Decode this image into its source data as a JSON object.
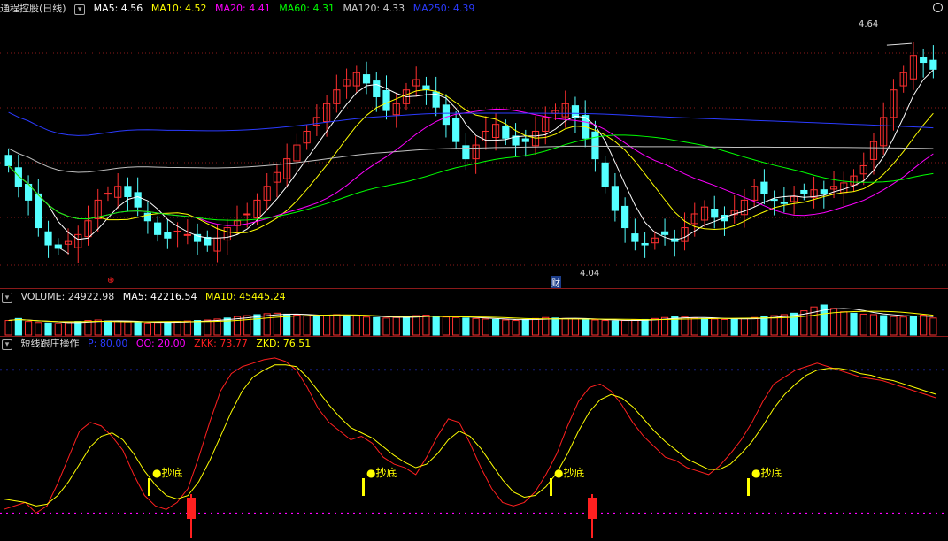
{
  "colors": {
    "ma5": "#ffffff",
    "ma10": "#ffff00",
    "ma20": "#ff00ff",
    "ma60": "#00ff00",
    "ma120": "#c0c0c0",
    "ma250": "#2b3bff",
    "up": "#ff3030",
    "down": "#54ffff",
    "zkk": "#ff2020",
    "zkd": "#ffff00",
    "grid": "#8b1a1a"
  },
  "price_header": {
    "title": "通程控股(日线)",
    "ma5": "MA5: 4.56",
    "ma10": "MA10: 4.52",
    "ma20": "MA20: 4.41",
    "ma60": "MA60: 4.31",
    "ma120": "MA120: 4.33",
    "ma250": "MA250: 4.39"
  },
  "volume_header": {
    "title": "VOLUME: 24922.98",
    "ma5": "MA5: 42216.54",
    "ma10": "MA10: 45445.24"
  },
  "indicator_header": {
    "title": "短线跟庄操作",
    "p": "P: 80.00",
    "oo": "OO: 20.00",
    "zkk": "ZKK: 73.77",
    "zkd": "ZKD: 76.51"
  },
  "annotations": {
    "high_label": "4.64",
    "low_label": "4.04",
    "finance_marker": "财",
    "red_marker": "⊕",
    "buy_signal": "抄底"
  },
  "chart_data": [
    {
      "type": "candlestick",
      "title": "通程控股(日线)",
      "ylim": [
        3.95,
        4.72
      ],
      "series_names": [
        "MA5",
        "MA10",
        "MA20",
        "MA60",
        "MA120",
        "MA250"
      ],
      "close": [
        4.28,
        4.22,
        4.18,
        4.1,
        4.05,
        4.04,
        4.06,
        4.08,
        4.12,
        4.18,
        4.2,
        4.22,
        4.19,
        4.16,
        4.12,
        4.08,
        4.07,
        4.09,
        4.08,
        4.06,
        4.05,
        4.07,
        4.1,
        4.12,
        4.14,
        4.18,
        4.22,
        4.26,
        4.3,
        4.34,
        4.38,
        4.42,
        4.46,
        4.5,
        4.53,
        4.55,
        4.52,
        4.48,
        4.44,
        4.46,
        4.5,
        4.53,
        4.5,
        4.45,
        4.4,
        4.35,
        4.3,
        4.34,
        4.38,
        4.4,
        4.36,
        4.34,
        4.35,
        4.38,
        4.42,
        4.44,
        4.46,
        4.42,
        4.36,
        4.3,
        4.22,
        4.15,
        4.1,
        4.06,
        4.05,
        4.07,
        4.08,
        4.06,
        4.1,
        4.14,
        4.16,
        4.13,
        4.12,
        4.15,
        4.18,
        4.22,
        4.2,
        4.18,
        4.17,
        4.19,
        4.2,
        4.21,
        4.2,
        4.22,
        4.23,
        4.25,
        4.28,
        4.35,
        4.42,
        4.5,
        4.55,
        4.6,
        4.58,
        4.56
      ],
      "ma_last_values": {
        "MA5": 4.56,
        "MA10": 4.52,
        "MA20": 4.41,
        "MA60": 4.31,
        "MA120": 4.33,
        "MA250": 4.39
      },
      "high_mark": 4.64,
      "low_mark": 4.04
    },
    {
      "type": "bar",
      "title": "VOLUME",
      "values": [
        30,
        34,
        28,
        26,
        25,
        24,
        26,
        28,
        30,
        31,
        29,
        28,
        27,
        26,
        25,
        26,
        27,
        28,
        29,
        30,
        31,
        33,
        35,
        38,
        40,
        42,
        44,
        45,
        43,
        41,
        39,
        38,
        40,
        42,
        41,
        39,
        37,
        36,
        35,
        36,
        38,
        40,
        41,
        39,
        37,
        36,
        35,
        34,
        33,
        32,
        31,
        30,
        32,
        34,
        36,
        35,
        34,
        33,
        32,
        31,
        30,
        29,
        30,
        31,
        32,
        34,
        36,
        38,
        37,
        35,
        34,
        33,
        32,
        33,
        34,
        36,
        38,
        40,
        42,
        45,
        50,
        58,
        62,
        55,
        48,
        45,
        43,
        42,
        40,
        38,
        37,
        39,
        41,
        35
      ],
      "ma_last_values": {
        "VOLUME": 24922.98,
        "MA5": 42216.54,
        "MA10": 45445.24
      }
    },
    {
      "type": "line",
      "title": "短线跟庄操作",
      "ylim": [
        0,
        100
      ],
      "series": [
        {
          "name": "ZKK",
          "values": [
            10,
            12,
            14,
            8,
            12,
            25,
            40,
            55,
            60,
            58,
            52,
            44,
            30,
            18,
            12,
            10,
            14,
            22,
            40,
            60,
            78,
            88,
            92,
            94,
            96,
            97,
            95,
            90,
            80,
            68,
            60,
            55,
            50,
            52,
            48,
            40,
            36,
            34,
            30,
            40,
            52,
            62,
            60,
            48,
            34,
            22,
            14,
            12,
            14,
            20,
            30,
            42,
            58,
            72,
            80,
            82,
            78,
            70,
            60,
            52,
            46,
            40,
            38,
            34,
            32,
            30,
            35,
            42,
            50,
            60,
            72,
            82,
            86,
            90,
            92,
            94,
            92,
            90,
            88,
            86,
            85,
            84,
            82,
            80,
            78,
            76,
            74
          ]
        },
        {
          "name": "ZKD",
          "values": [
            16,
            15,
            14,
            12,
            13,
            18,
            26,
            36,
            46,
            52,
            54,
            50,
            42,
            32,
            24,
            18,
            16,
            18,
            26,
            38,
            52,
            66,
            78,
            86,
            90,
            93,
            93,
            92,
            86,
            78,
            70,
            63,
            57,
            54,
            51,
            46,
            41,
            37,
            34,
            36,
            42,
            50,
            55,
            52,
            45,
            36,
            27,
            20,
            17,
            18,
            23,
            31,
            42,
            55,
            66,
            73,
            76,
            74,
            69,
            62,
            55,
            49,
            44,
            39,
            36,
            33,
            33,
            36,
            42,
            49,
            58,
            68,
            76,
            82,
            87,
            90,
            91,
            91,
            90,
            88,
            87,
            85,
            84,
            82,
            80,
            78,
            76
          ]
        }
      ],
      "levels": {
        "P": 80.0,
        "OO": 20.0
      },
      "last_values": {
        "ZKK": 73.77,
        "ZKD": 76.51
      }
    }
  ]
}
